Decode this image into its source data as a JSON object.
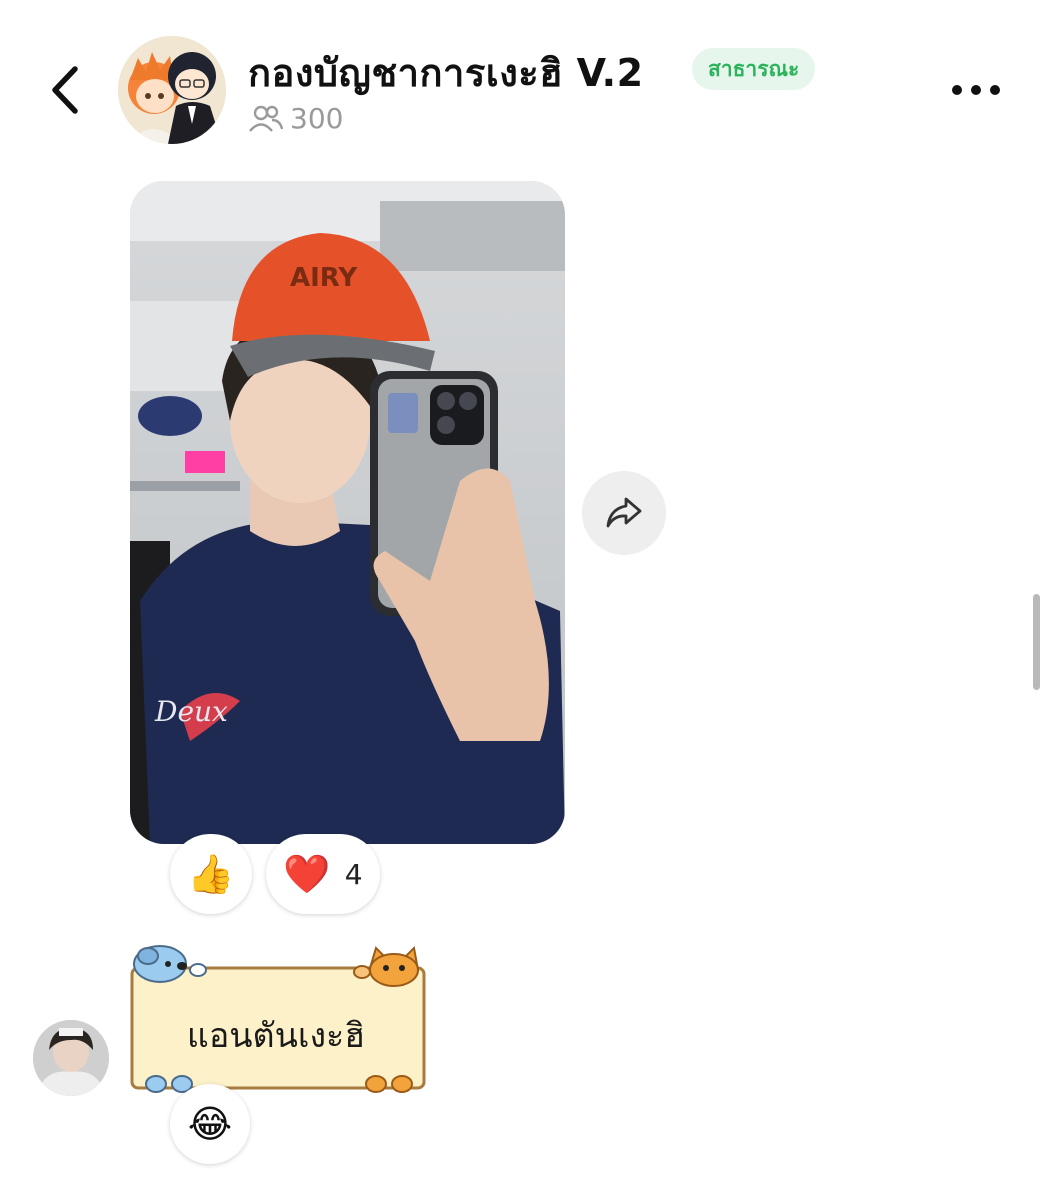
{
  "header": {
    "group_name": "กองบัญชาการเงะฮิ V.2",
    "badge": "สาธารณะ",
    "member_count": "300",
    "member_icon": "people-icon",
    "back_icon": "chevron-left-icon",
    "more_icon": "more-horizontal-icon"
  },
  "message_photo": {
    "share_icon": "share-arrow-icon",
    "reactions": [
      {
        "emoji": "👍",
        "count": ""
      },
      {
        "emoji": "❤️",
        "count": "4"
      }
    ]
  },
  "message_sticker": {
    "text": "แอนตันเงะฮิ",
    "reactions": [
      {
        "emoji": "😂",
        "count": ""
      }
    ]
  },
  "colors": {
    "badge_bg": "#e6f6ec",
    "badge_text": "#2bb35a",
    "sticker_bg": "#fdf1c9"
  }
}
